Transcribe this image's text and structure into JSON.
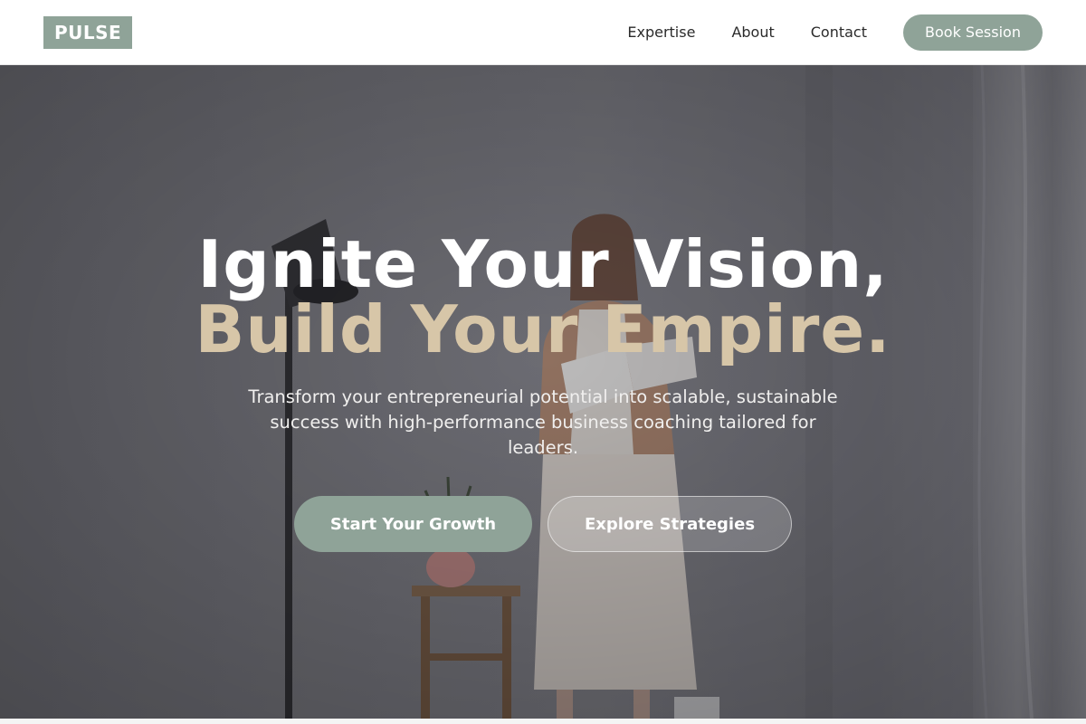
{
  "brand": {
    "logo_text": "PULSE",
    "accent_color": "#8fa398",
    "highlight_color": "#d7c6a8"
  },
  "nav": {
    "links": [
      {
        "label": "Expertise"
      },
      {
        "label": "About"
      },
      {
        "label": "Contact"
      }
    ],
    "cta_label": "Book Session"
  },
  "hero": {
    "headline_line1": "Ignite Your Vision,",
    "headline_line2": "Build Your Empire.",
    "subtitle": "Transform your entrepreneurial potential into scalable, sustainable success with high-performance business coaching tailored for leaders.",
    "primary_cta": "Start Your Growth",
    "secondary_cta": "Explore Strategies",
    "background_image": "woman-holding-book-photo"
  }
}
